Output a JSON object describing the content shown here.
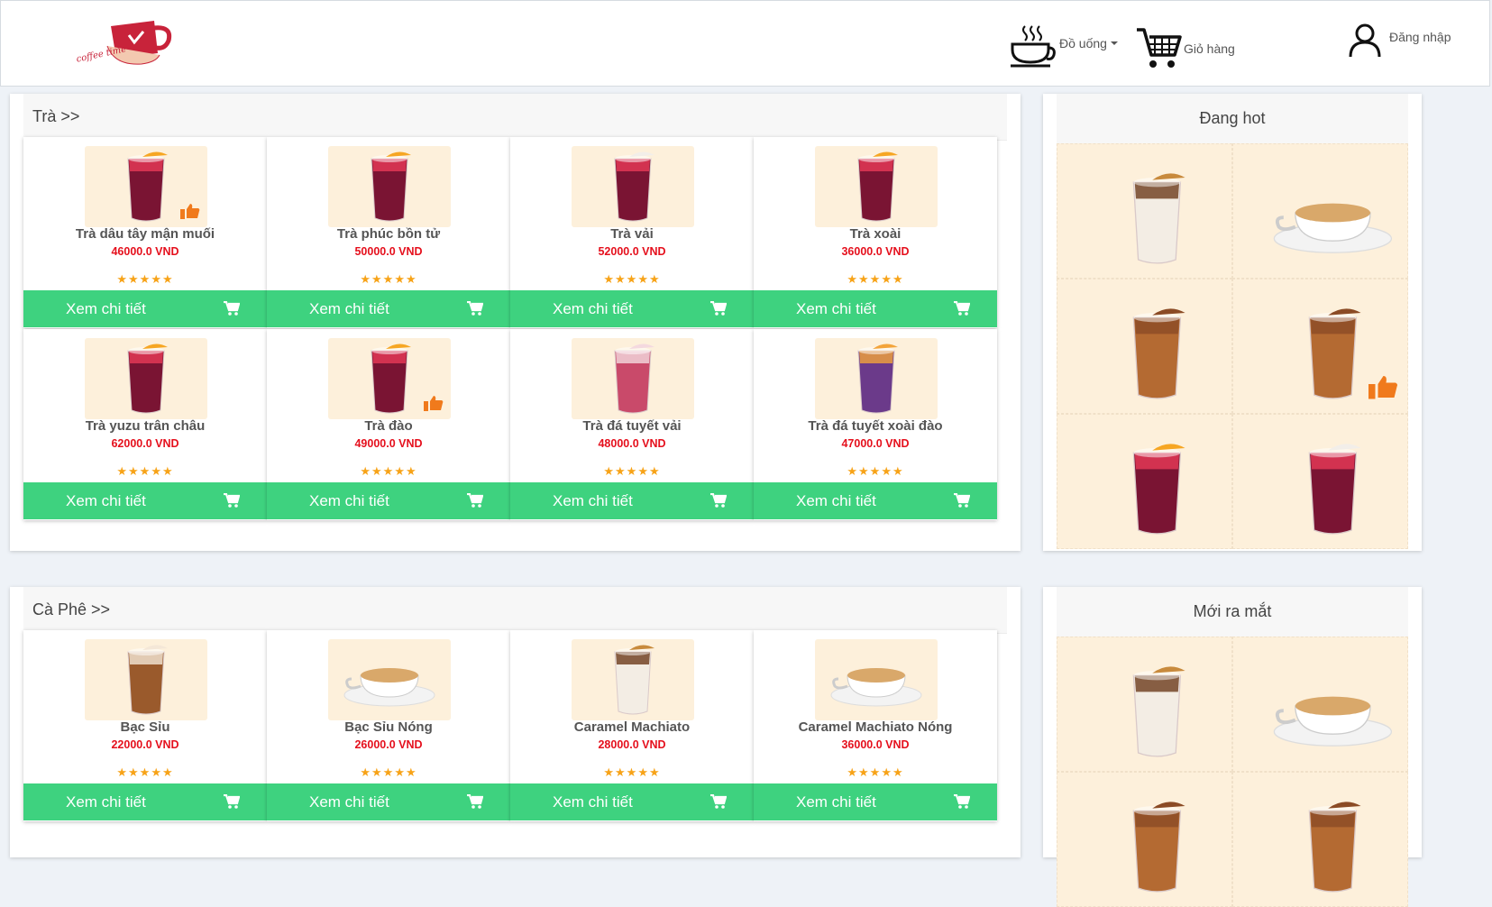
{
  "header": {
    "logo_text": "coffee time",
    "drinks_label": "Đồ uống",
    "cart_label": "Giỏ hàng",
    "login_label": "Đăng nhập"
  },
  "sections": [
    {
      "title": "Trà >>",
      "products": [
        {
          "name": "Trà dâu tây mận muối",
          "price": "46000.0 VND",
          "stars": "★★★★★",
          "button": "Xem chi tiết"
        },
        {
          "name": "Trà phúc bồn tử",
          "price": "50000.0 VND",
          "stars": "★★★★★",
          "button": "Xem chi tiết"
        },
        {
          "name": "Trà vải",
          "price": "52000.0 VND",
          "stars": "★★★★★",
          "button": "Xem chi tiết"
        },
        {
          "name": "Trà xoài",
          "price": "36000.0 VND",
          "stars": "★★★★★",
          "button": "Xem chi tiết"
        },
        {
          "name": "Trà yuzu trân châu",
          "price": "62000.0 VND",
          "stars": "★★★★★",
          "button": "Xem chi tiết"
        },
        {
          "name": "Trà đào",
          "price": "49000.0 VND",
          "stars": "★★★★★",
          "button": "Xem chi tiết"
        },
        {
          "name": "Trà đá tuyết vải",
          "price": "48000.0 VND",
          "stars": "★★★★★",
          "button": "Xem chi tiết"
        },
        {
          "name": "Trà đá tuyết xoài đào",
          "price": "47000.0 VND",
          "stars": "★★★★★",
          "button": "Xem chi tiết"
        }
      ]
    },
    {
      "title": "Cà Phê >>",
      "products": [
        {
          "name": "Bạc Sỉu",
          "price": "22000.0 VND",
          "stars": "★★★★★",
          "button": "Xem chi tiết"
        },
        {
          "name": "Bạc Sỉu Nóng",
          "price": "26000.0 VND",
          "stars": "★★★★★",
          "button": "Xem chi tiết"
        },
        {
          "name": "Caramel Machiato",
          "price": "28000.0 VND",
          "stars": "★★★★★",
          "button": "Xem chi tiết"
        },
        {
          "name": "Caramel Machiato Nóng",
          "price": "36000.0 VND",
          "stars": "★★★★★",
          "button": "Xem chi tiết"
        }
      ]
    }
  ],
  "sidebar": {
    "hot_title": "Đang hot",
    "new_title": "Mới ra mắt"
  },
  "colors": {
    "accent_green": "#3ed27f",
    "price_red": "#e5101d",
    "star_orange": "#f7a318",
    "thumb_bg": "#fdf0db"
  },
  "icons": [
    "coffee-cup-icon",
    "cart-icon",
    "user-icon",
    "caret-down-icon",
    "star-icon",
    "thumbs-up-icon"
  ]
}
